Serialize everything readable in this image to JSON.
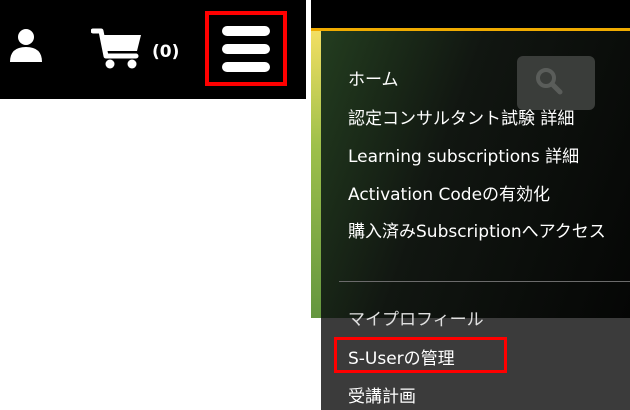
{
  "header": {
    "user_icon": "user-icon",
    "cart_icon": "cart-icon",
    "cart_count": "(0)",
    "menu_icon": "hamburger-menu-icon"
  },
  "menu": {
    "search_icon": "search-icon",
    "items": [
      {
        "label": "ホーム"
      },
      {
        "label": "認定コンサルタント試験 詳細"
      },
      {
        "label": "Learning subscriptions 詳細"
      },
      {
        "label": "Activation Codeの有効化"
      },
      {
        "label": "購入済みSubscriptionへアクセス"
      }
    ],
    "account_items": [
      {
        "label": "マイプロフィール"
      },
      {
        "label": "S-Userの管理"
      },
      {
        "label": "受講計画"
      }
    ]
  },
  "colors": {
    "highlight": "#ff0000",
    "accent_bar": "#f0ab00",
    "header_bg": "#000000"
  }
}
